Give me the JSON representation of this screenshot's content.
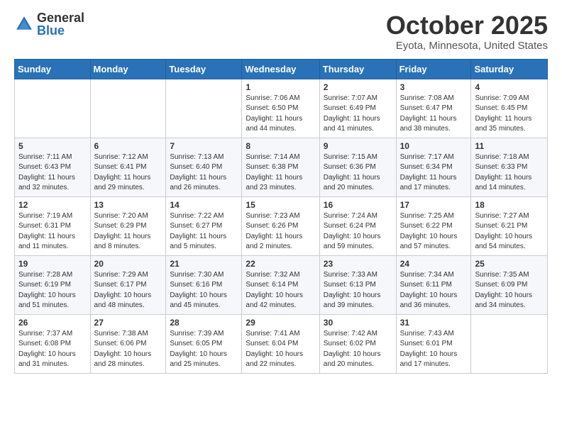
{
  "logo": {
    "general": "General",
    "blue": "Blue"
  },
  "title": {
    "month": "October 2025",
    "location": "Eyota, Minnesota, United States"
  },
  "days_of_week": [
    "Sunday",
    "Monday",
    "Tuesday",
    "Wednesday",
    "Thursday",
    "Friday",
    "Saturday"
  ],
  "weeks": [
    [
      {
        "day": "",
        "info": ""
      },
      {
        "day": "",
        "info": ""
      },
      {
        "day": "",
        "info": ""
      },
      {
        "day": "1",
        "info": "Sunrise: 7:06 AM\nSunset: 6:50 PM\nDaylight: 11 hours\nand 44 minutes."
      },
      {
        "day": "2",
        "info": "Sunrise: 7:07 AM\nSunset: 6:49 PM\nDaylight: 11 hours\nand 41 minutes."
      },
      {
        "day": "3",
        "info": "Sunrise: 7:08 AM\nSunset: 6:47 PM\nDaylight: 11 hours\nand 38 minutes."
      },
      {
        "day": "4",
        "info": "Sunrise: 7:09 AM\nSunset: 6:45 PM\nDaylight: 11 hours\nand 35 minutes."
      }
    ],
    [
      {
        "day": "5",
        "info": "Sunrise: 7:11 AM\nSunset: 6:43 PM\nDaylight: 11 hours\nand 32 minutes."
      },
      {
        "day": "6",
        "info": "Sunrise: 7:12 AM\nSunset: 6:41 PM\nDaylight: 11 hours\nand 29 minutes."
      },
      {
        "day": "7",
        "info": "Sunrise: 7:13 AM\nSunset: 6:40 PM\nDaylight: 11 hours\nand 26 minutes."
      },
      {
        "day": "8",
        "info": "Sunrise: 7:14 AM\nSunset: 6:38 PM\nDaylight: 11 hours\nand 23 minutes."
      },
      {
        "day": "9",
        "info": "Sunrise: 7:15 AM\nSunset: 6:36 PM\nDaylight: 11 hours\nand 20 minutes."
      },
      {
        "day": "10",
        "info": "Sunrise: 7:17 AM\nSunset: 6:34 PM\nDaylight: 11 hours\nand 17 minutes."
      },
      {
        "day": "11",
        "info": "Sunrise: 7:18 AM\nSunset: 6:33 PM\nDaylight: 11 hours\nand 14 minutes."
      }
    ],
    [
      {
        "day": "12",
        "info": "Sunrise: 7:19 AM\nSunset: 6:31 PM\nDaylight: 11 hours\nand 11 minutes."
      },
      {
        "day": "13",
        "info": "Sunrise: 7:20 AM\nSunset: 6:29 PM\nDaylight: 11 hours\nand 8 minutes."
      },
      {
        "day": "14",
        "info": "Sunrise: 7:22 AM\nSunset: 6:27 PM\nDaylight: 11 hours\nand 5 minutes."
      },
      {
        "day": "15",
        "info": "Sunrise: 7:23 AM\nSunset: 6:26 PM\nDaylight: 11 hours\nand 2 minutes."
      },
      {
        "day": "16",
        "info": "Sunrise: 7:24 AM\nSunset: 6:24 PM\nDaylight: 10 hours\nand 59 minutes."
      },
      {
        "day": "17",
        "info": "Sunrise: 7:25 AM\nSunset: 6:22 PM\nDaylight: 10 hours\nand 57 minutes."
      },
      {
        "day": "18",
        "info": "Sunrise: 7:27 AM\nSunset: 6:21 PM\nDaylight: 10 hours\nand 54 minutes."
      }
    ],
    [
      {
        "day": "19",
        "info": "Sunrise: 7:28 AM\nSunset: 6:19 PM\nDaylight: 10 hours\nand 51 minutes."
      },
      {
        "day": "20",
        "info": "Sunrise: 7:29 AM\nSunset: 6:17 PM\nDaylight: 10 hours\nand 48 minutes."
      },
      {
        "day": "21",
        "info": "Sunrise: 7:30 AM\nSunset: 6:16 PM\nDaylight: 10 hours\nand 45 minutes."
      },
      {
        "day": "22",
        "info": "Sunrise: 7:32 AM\nSunset: 6:14 PM\nDaylight: 10 hours\nand 42 minutes."
      },
      {
        "day": "23",
        "info": "Sunrise: 7:33 AM\nSunset: 6:13 PM\nDaylight: 10 hours\nand 39 minutes."
      },
      {
        "day": "24",
        "info": "Sunrise: 7:34 AM\nSunset: 6:11 PM\nDaylight: 10 hours\nand 36 minutes."
      },
      {
        "day": "25",
        "info": "Sunrise: 7:35 AM\nSunset: 6:09 PM\nDaylight: 10 hours\nand 34 minutes."
      }
    ],
    [
      {
        "day": "26",
        "info": "Sunrise: 7:37 AM\nSunset: 6:08 PM\nDaylight: 10 hours\nand 31 minutes."
      },
      {
        "day": "27",
        "info": "Sunrise: 7:38 AM\nSunset: 6:06 PM\nDaylight: 10 hours\nand 28 minutes."
      },
      {
        "day": "28",
        "info": "Sunrise: 7:39 AM\nSunset: 6:05 PM\nDaylight: 10 hours\nand 25 minutes."
      },
      {
        "day": "29",
        "info": "Sunrise: 7:41 AM\nSunset: 6:04 PM\nDaylight: 10 hours\nand 22 minutes."
      },
      {
        "day": "30",
        "info": "Sunrise: 7:42 AM\nSunset: 6:02 PM\nDaylight: 10 hours\nand 20 minutes."
      },
      {
        "day": "31",
        "info": "Sunrise: 7:43 AM\nSunset: 6:01 PM\nDaylight: 10 hours\nand 17 minutes."
      },
      {
        "day": "",
        "info": ""
      }
    ]
  ]
}
